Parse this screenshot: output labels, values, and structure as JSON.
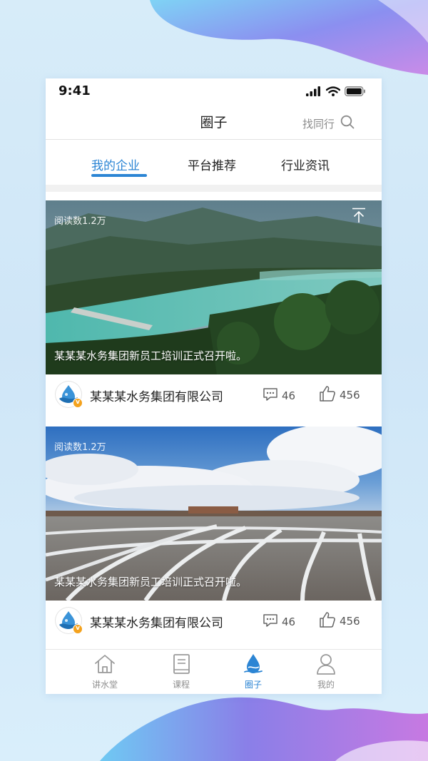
{
  "status_bar": {
    "time": "9:41"
  },
  "nav": {
    "title": "圈子",
    "search_label": "找同行"
  },
  "tabs": [
    {
      "label": "我的企业",
      "active": true
    },
    {
      "label": "平台推荐",
      "active": false
    },
    {
      "label": "行业资讯",
      "active": false
    }
  ],
  "posts": [
    {
      "read_count": "阅读数1.2万",
      "caption": "某某某水务集团新员工培训正式召开啦。",
      "company": "某某某水务集团有限公司",
      "verified_badge": "v",
      "comments": "46",
      "likes": "456"
    },
    {
      "read_count": "阅读数1.2万",
      "caption": "某某某水务集团新员工培训正式召开啦。",
      "company": "某某某水务集团有限公司",
      "verified_badge": "v",
      "comments": "46",
      "likes": "456"
    }
  ],
  "bottom_tabs": [
    {
      "label": "讲水堂",
      "icon": "house-icon",
      "active": false
    },
    {
      "label": "课程",
      "icon": "book-icon",
      "active": false
    },
    {
      "label": "圈子",
      "icon": "water-drop-icon",
      "active": true
    },
    {
      "label": "我的",
      "icon": "person-icon",
      "active": false
    }
  ],
  "colors": {
    "accent": "#2c85d4",
    "badge": "#f4a21d",
    "background": "#d7ecf9"
  }
}
